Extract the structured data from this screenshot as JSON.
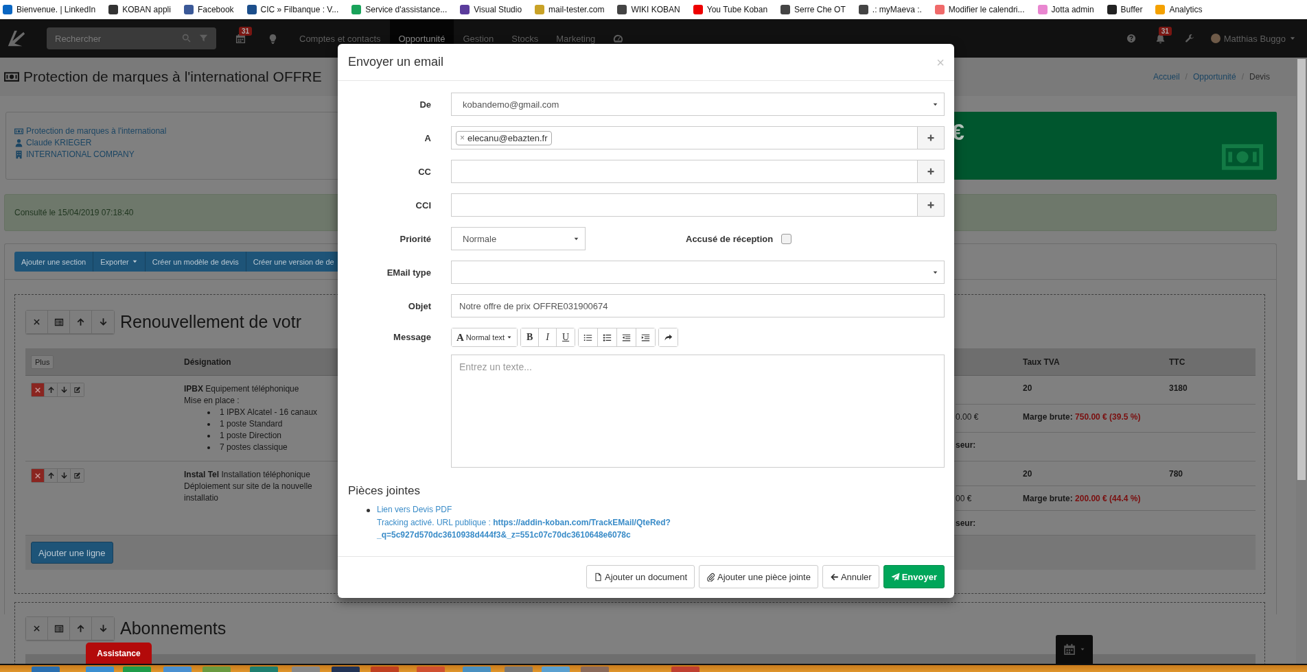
{
  "bookmarks": [
    {
      "label": "Bienvenue. | LinkedIn"
    },
    {
      "label": "KOBAN appli"
    },
    {
      "label": "Facebook"
    },
    {
      "label": "CIC » Filbanque : V..."
    },
    {
      "label": "Service d'assistance..."
    },
    {
      "label": "Visual Studio"
    },
    {
      "label": "mail-tester.com"
    },
    {
      "label": "WIKI KOBAN"
    },
    {
      "label": "You Tube Koban"
    },
    {
      "label": "Serre Che OT"
    },
    {
      "label": ".: myMaeva :."
    },
    {
      "label": "Modifier le calendri..."
    },
    {
      "label": "Jotta admin"
    },
    {
      "label": "Buffer"
    },
    {
      "label": "Analytics"
    }
  ],
  "nav": {
    "search": {
      "placeholder": "Rechercher"
    },
    "calendar_badge": "31",
    "menu": [
      {
        "label": "Comptes et contacts",
        "selected": false
      },
      {
        "label": "Opportunité",
        "selected": true
      },
      {
        "label": "Gestion",
        "selected": false
      },
      {
        "label": "Stocks",
        "selected": false
      },
      {
        "label": "Marketing",
        "selected": false
      }
    ],
    "notifications_badge": "31",
    "user": "Matthias Buggo"
  },
  "page": {
    "title": "Protection de marques à l'international OFFRE",
    "breadcrumb": [
      {
        "label": "Accueil",
        "kind": "link"
      },
      {
        "label": "/",
        "kind": "separator"
      },
      {
        "label": "Opportunité",
        "kind": "link"
      },
      {
        "label": "/",
        "kind": "separator"
      },
      {
        "label": "Devis",
        "kind": "current"
      }
    ],
    "info_links": [
      {
        "label": "Protection de marques à l'international",
        "kind": "opportunity"
      },
      {
        "label": "Claude KRIEGER",
        "kind": "contact"
      },
      {
        "label": "INTERNATIONAL COMPANY",
        "kind": "company"
      }
    ],
    "amount": "€",
    "alert": "Consulté le 15/04/2019 07:18:40",
    "toolbar": [
      {
        "label": "Ajouter une section",
        "dropdown": false
      },
      {
        "label": "Exporter",
        "dropdown": true
      },
      {
        "label": "Créer un modèle de devis",
        "dropdown": false
      },
      {
        "label": "Créer une version de de",
        "dropdown": false
      }
    ],
    "sections": [
      {
        "title": "Renouvellement de votr",
        "header_button": "Plus",
        "columns": [
          "Désignation",
          "Taux TVA",
          "TTC"
        ],
        "rows": [
          {
            "name": "IPBX",
            "description": "Equipement téléphonique",
            "details": "Mise en place :",
            "bullets": [
              "1 IPBX Alcatel - 16 canaux",
              "1 poste Standard",
              "1 poste Direction",
              "7 postes classique"
            ],
            "tva": "20",
            "ttc": "3180",
            "cost": "0.00 €",
            "margin_label": "Marge brute:",
            "margin_value": "750.00 € (39.5 %)",
            "supplier": "seur:"
          },
          {
            "name": "Instal Tel",
            "description": "Installation téléphonique",
            "details": "Déploiement sur site de la nouvelle installatio",
            "bullets": [],
            "tva": "20",
            "ttc": "780",
            "cost": "00 €",
            "margin_label": "Marge brute:",
            "margin_value": "200.00 € (44.4 %)",
            "supplier": "seur:"
          }
        ],
        "add_line": "Ajouter une ligne"
      },
      {
        "title": "Abonnements"
      }
    ]
  },
  "modal": {
    "title": "Envoyer un email",
    "close": "×",
    "fields": [
      {
        "label": "De",
        "kind": "select",
        "value": "kobandemo@gmail.com"
      },
      {
        "label": "A",
        "kind": "tags",
        "tags": [
          {
            "label": "elecanu@ebazten.fr",
            "remove": "×"
          }
        ],
        "add": true
      },
      {
        "label": "CC",
        "kind": "tags",
        "add": true
      },
      {
        "label": "CCI",
        "kind": "tags",
        "add": true
      },
      {
        "label": "Priorité",
        "kind": "select_check",
        "value": "Normale",
        "check_label": "Accusé de réception",
        "checked": false
      },
      {
        "label": "EMail type",
        "kind": "select"
      },
      {
        "label": "Objet",
        "kind": "text",
        "value": "Notre offre de prix OFFRE031900674"
      },
      {
        "label": "Message",
        "kind": "editor",
        "style_glyph": "A",
        "style_label": "Normal text",
        "format": [
          "B",
          "I",
          "U"
        ],
        "placeholder": "Entrez un texte..."
      }
    ],
    "attachments": {
      "title": "Pièces jointes",
      "items": [
        {
          "link": "Lien vers Devis PDF",
          "tracking": "Tracking activé. URL publique : **https://addin-koban.com/TrackEMail/QteRed?_q=5c927d570dc3610938d444f3&_z=551c07c70dc3610648e6078c**"
        }
      ]
    },
    "buttons": [
      {
        "label": "Ajouter un document",
        "kind": "document"
      },
      {
        "label": "Ajouter une pièce jointe",
        "kind": "attach"
      },
      {
        "label": "Annuler",
        "kind": "cancel"
      },
      {
        "label": "Envoyer",
        "kind": "send"
      }
    ]
  },
  "assistance": "Assistance"
}
